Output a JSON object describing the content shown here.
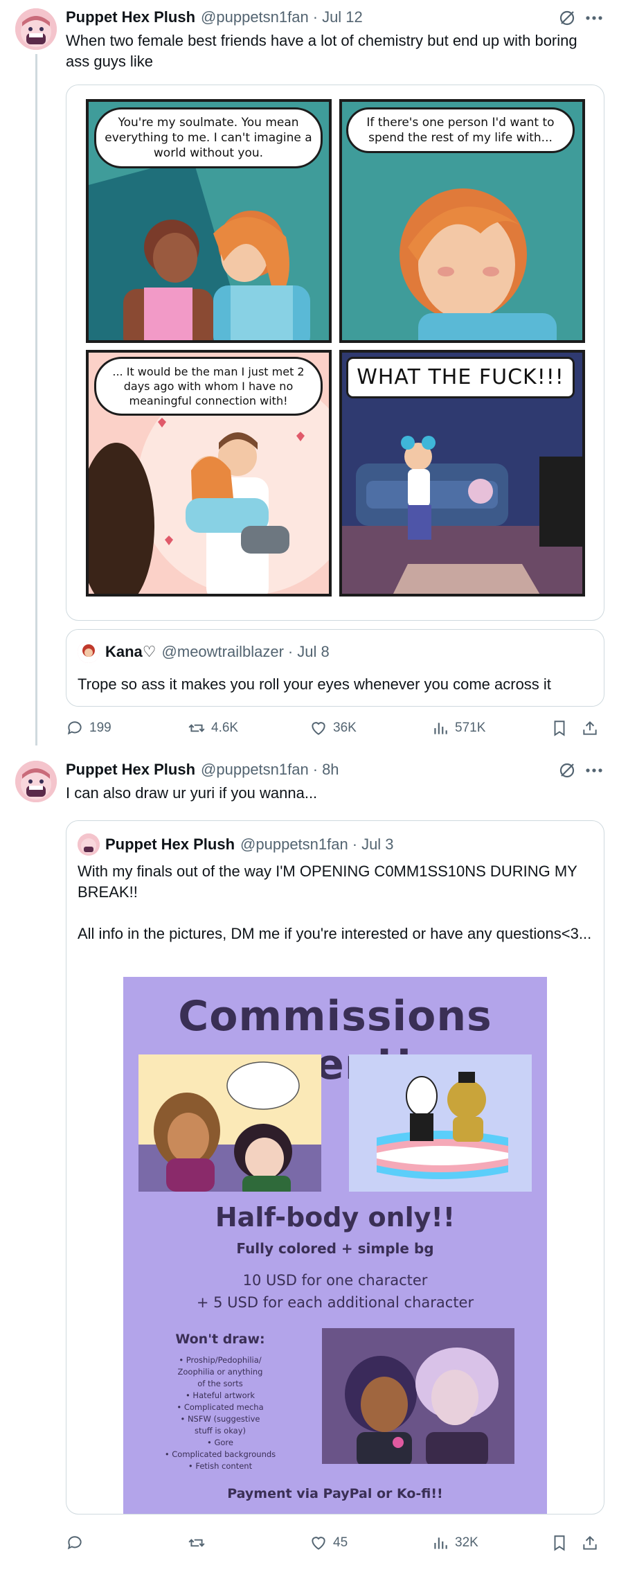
{
  "tweet1": {
    "author": {
      "name": "Puppet Hex Plush",
      "handle": "@puppetsn1fan",
      "time": "Jul 12"
    },
    "text": "When two female best friends have a lot of chemistry but end up with boring ass guys like",
    "comic": {
      "panel1": "You're my soulmate. You mean everything to me. I can't imagine a world without you.",
      "panel2": "If there's one person I'd want to spend the rest of my life with...",
      "panel3": "... It would be the man I just met 2 days ago with whom I have no meaningful connection with!",
      "panel4": "WHAT THE FUCK!!!"
    },
    "quote": {
      "name": "Kana♡",
      "handle": "@meowtrailblazer",
      "time": "Jul 8",
      "text": "Trope so ass it makes you roll your eyes whenever you come across it"
    },
    "actions": {
      "replies": "199",
      "reposts": "4.6K",
      "likes": "36K",
      "views": "571K"
    }
  },
  "tweet2": {
    "author": {
      "name": "Puppet Hex Plush",
      "handle": "@puppetsn1fan",
      "time": "8h"
    },
    "text": "I can also draw ur yuri if you wanna...",
    "quote": {
      "name": "Puppet Hex Plush",
      "handle": "@puppetsn1fan",
      "time": "Jul 3",
      "text_line1": "With my finals out of the way I'M OPENING C0MM1SS10NS DURING MY BREAK!!",
      "text_line2": "All info in the pictures, DM me if you're interested or have any questions<3...",
      "poster": {
        "title": "Commissions open!!",
        "subtitle": "Half-body only!!",
        "colored": "Fully colored + simple bg",
        "price1": "10 USD for one character",
        "price2": "+ 5 USD for each additional character",
        "wont_title": "Won't draw:",
        "wont_items": [
          "• Proship/Pedophilia/",
          "Zoophilia or anything",
          "of the sorts",
          "• Hateful artwork",
          "• Complicated mecha",
          "• NSFW (suggestive",
          "stuff is okay)",
          "• Gore",
          "• Complicated backgrounds",
          "• Fetish content"
        ],
        "payment": "Payment via PayPal or Ko-fi!!"
      }
    },
    "actions": {
      "replies": "",
      "reposts": "",
      "likes": "45",
      "views": "32K"
    }
  },
  "colors": {
    "text": "#0f1419",
    "secondary": "#536471",
    "border": "#cfd9de",
    "poster_bg": "#b3a4ea"
  }
}
